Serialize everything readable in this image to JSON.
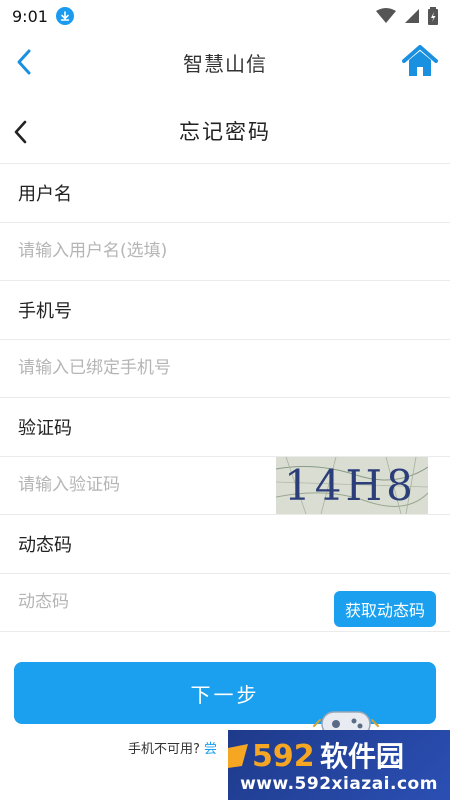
{
  "status_bar": {
    "time": "9:01"
  },
  "app_bar": {
    "title": "智慧山信"
  },
  "page": {
    "title": "忘记密码"
  },
  "form": {
    "username_label": "用户名",
    "username_placeholder": "请输入用户名(选填)",
    "phone_label": "手机号",
    "phone_placeholder": "请输入已绑定手机号",
    "captcha_label": "验证码",
    "captcha_placeholder": "请输入验证码",
    "captcha_text": "14H8",
    "dynamic_label": "动态码",
    "dynamic_placeholder": "动态码",
    "get_code_label": "获取动态码"
  },
  "next_button": "下一步",
  "bottom_hint": {
    "text": "手机不可用?",
    "link": "尝"
  },
  "watermark": {
    "logo": "592软件园",
    "url": "www.592xiazai.com"
  },
  "colors": {
    "accent": "#1aa0ef",
    "placeholder": "#b5b5b5",
    "watermark_bg": "#1e3a8a"
  }
}
